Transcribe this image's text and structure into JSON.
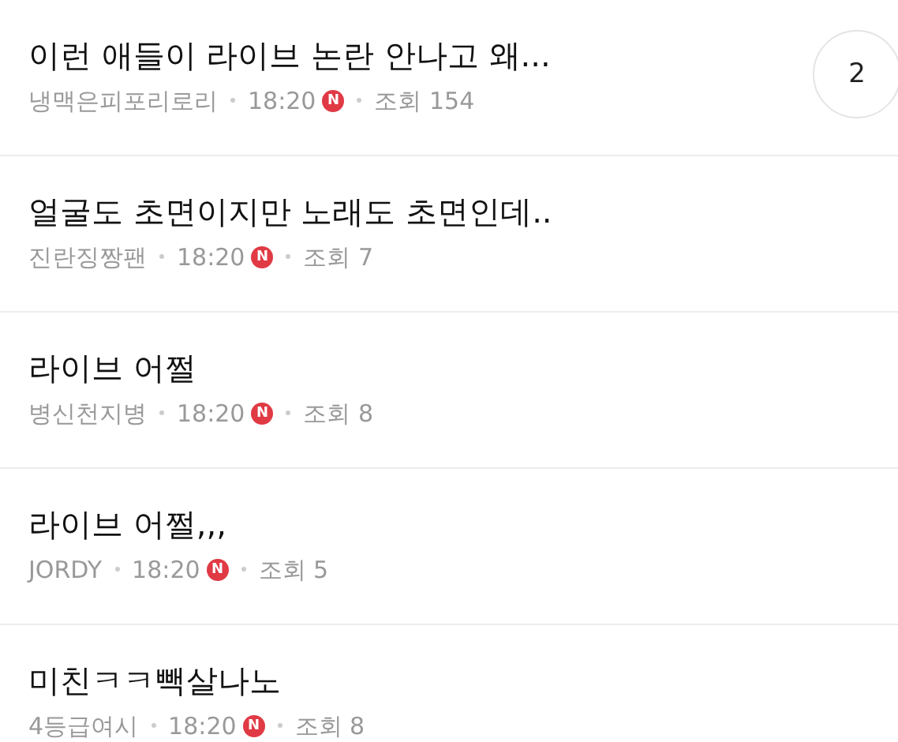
{
  "posts": [
    {
      "title": "이런 애들이 라이브 논란 안나고 왜...",
      "author": "냉맥은피포리로리",
      "time": "18:20",
      "new_badge": "N",
      "views": "조회 154",
      "comments": "2"
    },
    {
      "title": "얼굴도 초면이지만 노래도 초면인데..",
      "author": "진란징짱팬",
      "time": "18:20",
      "new_badge": "N",
      "views": "조회 7"
    },
    {
      "title": "라이브 어쩔",
      "author": "병신천지병",
      "time": "18:20",
      "new_badge": "N",
      "views": "조회 8"
    },
    {
      "title": "라이브 어쩔,,,",
      "author": "JORDY",
      "time": "18:20",
      "new_badge": "N",
      "views": "조회 5"
    },
    {
      "title": "미친ㅋㅋ빽살나노",
      "author": "4등급여시",
      "time": "18:20",
      "new_badge": "N",
      "views": "조회 8"
    }
  ]
}
